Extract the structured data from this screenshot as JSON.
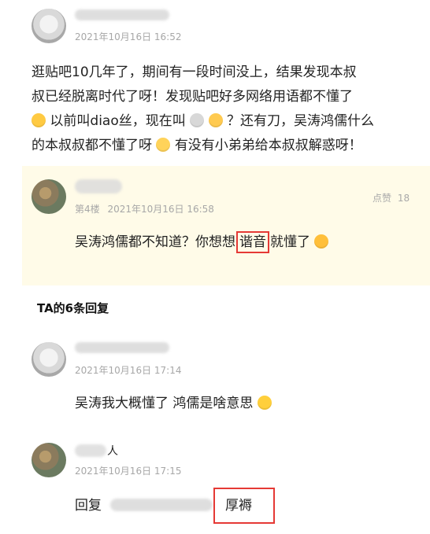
{
  "main_post": {
    "time": "2021年10月16日 16:52",
    "lines": [
      "逛贴吧10几年了，期间有一段时间没上，结果发现本叔",
      "叔已经脱离时代了呀！发现贴吧好多网络用语都不懂了",
      "以前叫diao丝，现在叫",
      "？还有刀，吴涛鸿儒什么",
      "的本叔叔都不懂了呀",
      "有没有小弟弟给本叔叔解惑呀！"
    ]
  },
  "featured_reply": {
    "floor": "第4楼",
    "time": "2021年10月16日 16:58",
    "likes_label": "点赞",
    "likes_count": "18",
    "text_before": "吴涛鸿儒都不知道？你想想",
    "highlight": "谐音",
    "text_after": "就懂了"
  },
  "replies_header": "TA的6条回复",
  "reply1": {
    "time": "2021年10月16日 17:14",
    "text": "吴涛我大概懂了 鸿儒是啥意思"
  },
  "reply2": {
    "name_visible": "人",
    "time": "2021年10月16日 17:15",
    "prefix": "回复",
    "highlight_text": "厚褥"
  },
  "colors": {
    "accent_red": "#e53935",
    "section_yellow": "#fffbe8"
  },
  "icons": {
    "emoji_sad": "sad-emoji",
    "emoji_mouse": "mouse-emoji",
    "emoji_kiss": "kiss-emoji",
    "emoji_frown": "frown-emoji",
    "emoji_hug": "hug-emoji",
    "emoji_pleading": "pleading-emoji"
  }
}
